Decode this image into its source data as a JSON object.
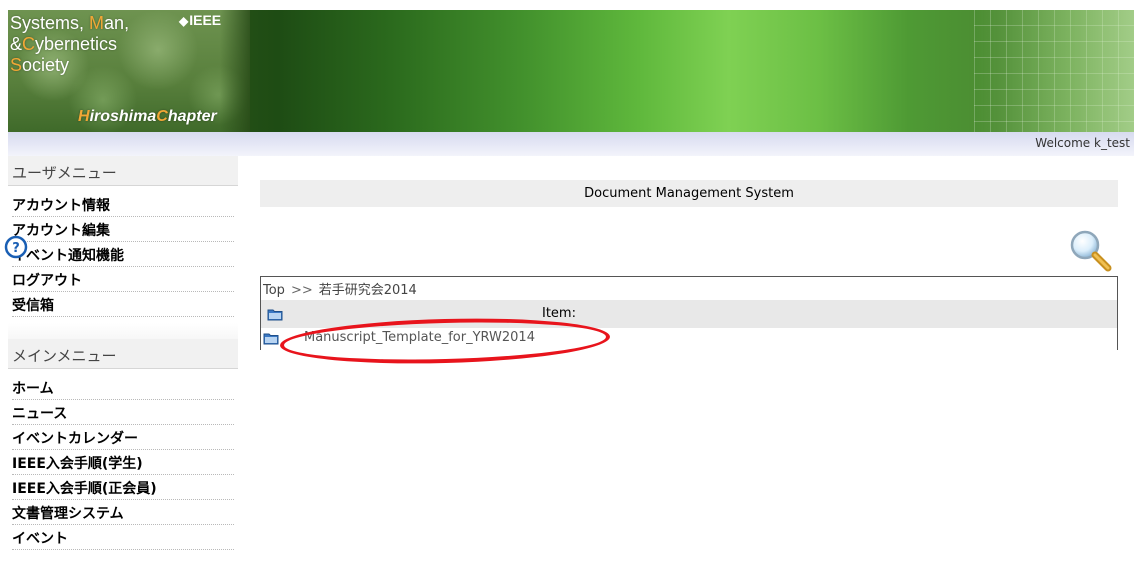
{
  "header": {
    "logo": {
      "line1_first": "S",
      "line1_mid": "ystems,",
      "line1_hl": "M",
      "line1_end": "an,",
      "line2_first": "&",
      "line2_hl": "C",
      "line2_end": "ybernetics",
      "line3_hl": "S",
      "line3_end": "ociety",
      "ieee": "IEEE",
      "chapter_hl1": "H",
      "chapter_part1": "iroshima",
      "chapter_hl2": "C",
      "chapter_part2": "hapter"
    },
    "welcome": "Welcome k_test"
  },
  "sidebar": {
    "user_menu": {
      "title": "ユーザメニュー",
      "items": [
        {
          "label": "アカウント情報"
        },
        {
          "label": "アカウント編集"
        },
        {
          "label": "イベント通知機能"
        },
        {
          "label": "ログアウト"
        },
        {
          "label": "受信箱"
        }
      ]
    },
    "main_menu": {
      "title": "メインメニュー",
      "items": [
        {
          "label": "ホーム"
        },
        {
          "label": "ニュース"
        },
        {
          "label": "イベントカレンダー"
        },
        {
          "label": "IEEE入会手順(学生)"
        },
        {
          "label": "IEEE入会手順(正会員)"
        },
        {
          "label": "文書管理システム"
        },
        {
          "label": "イベント"
        }
      ]
    }
  },
  "main": {
    "title": "Document Management System",
    "help_icon": "help-icon",
    "search_icon": "magnifier-search-icon",
    "breadcrumb": {
      "root": "Top",
      "separator": ">>",
      "current": "若手研究会2014"
    },
    "item_header": "Item:",
    "files": [
      {
        "name": "Manuscript_Template_for_YRW2014"
      }
    ]
  },
  "colors": {
    "highlight_oval": "#e8141c",
    "logo_accent": "#f2a735"
  }
}
